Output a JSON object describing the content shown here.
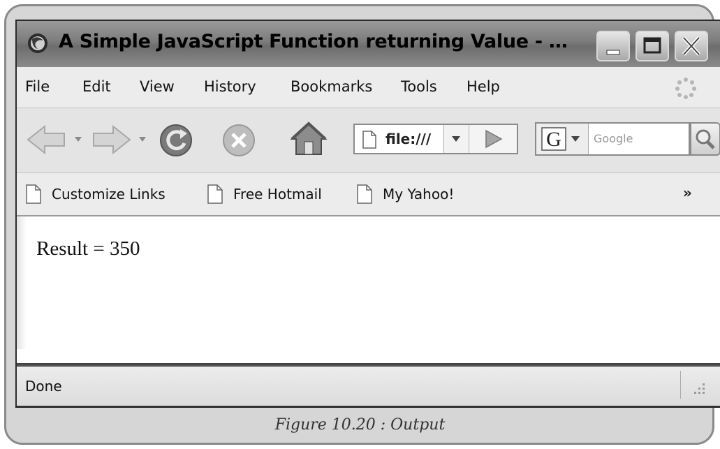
{
  "window": {
    "title": "A Simple JavaScript Function returning Value - …",
    "title_icon": "firefox-icon"
  },
  "menubar": {
    "items": [
      {
        "label": "File"
      },
      {
        "label": "Edit"
      },
      {
        "label": "View"
      },
      {
        "label": "History"
      },
      {
        "label": "Bookmarks"
      },
      {
        "label": "Tools"
      },
      {
        "label": "Help"
      }
    ]
  },
  "navbar": {
    "url": "file:///",
    "search_placeholder": "Google",
    "search_engine_letter": "G"
  },
  "bookmarks": {
    "items": [
      {
        "label": "Customize Links"
      },
      {
        "label": "Free Hotmail"
      },
      {
        "label": "My Yahoo!"
      }
    ],
    "overflow": "»"
  },
  "content": {
    "result": "Result = 350"
  },
  "status": {
    "text": "Done"
  },
  "caption": "Figure 10.20 : Output"
}
